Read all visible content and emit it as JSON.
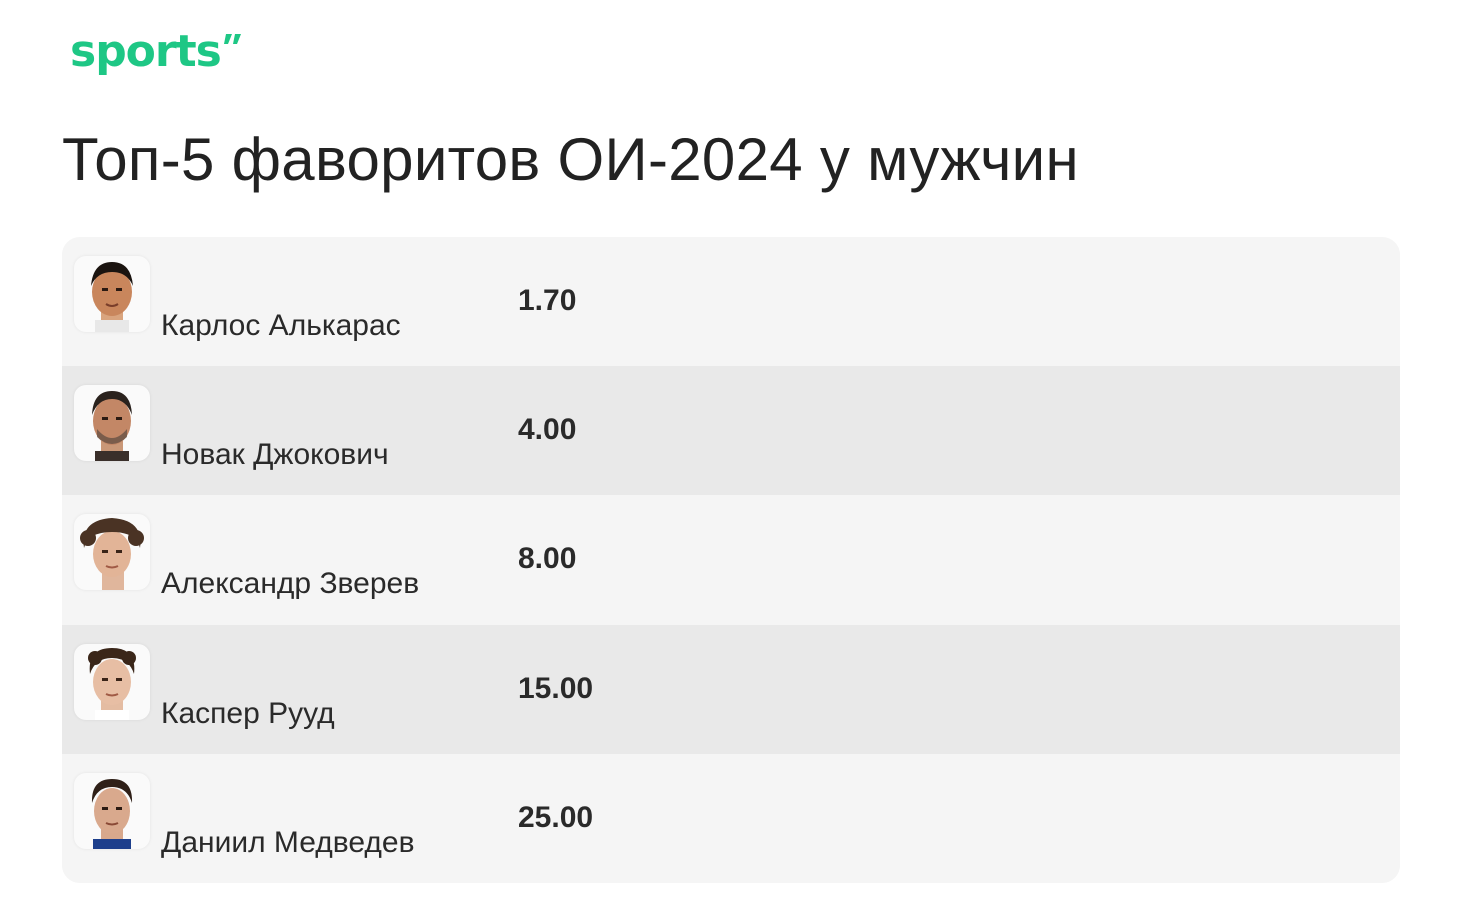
{
  "brand": {
    "logo_text": "sports",
    "accent_color": "#1ec785"
  },
  "title": "Топ-5 фаворитов ОИ-2024 у мужчин",
  "players": [
    {
      "name": "Карлос Алькарас",
      "odds": "1.70",
      "avatar_icon": "player-photo-icon"
    },
    {
      "name": "Новак Джокович",
      "odds": "4.00",
      "avatar_icon": "player-photo-icon"
    },
    {
      "name": "Александр Зверев",
      "odds": "8.00",
      "avatar_icon": "player-photo-icon"
    },
    {
      "name": "Каспер Рууд",
      "odds": "15.00",
      "avatar_icon": "player-photo-icon"
    },
    {
      "name": "Даниил Медведев",
      "odds": "25.00",
      "avatar_icon": "player-photo-icon"
    }
  ],
  "colors": {
    "row_light": "#f5f5f5",
    "row_dark": "#e9e9e9",
    "text": "#2a2a2a"
  }
}
